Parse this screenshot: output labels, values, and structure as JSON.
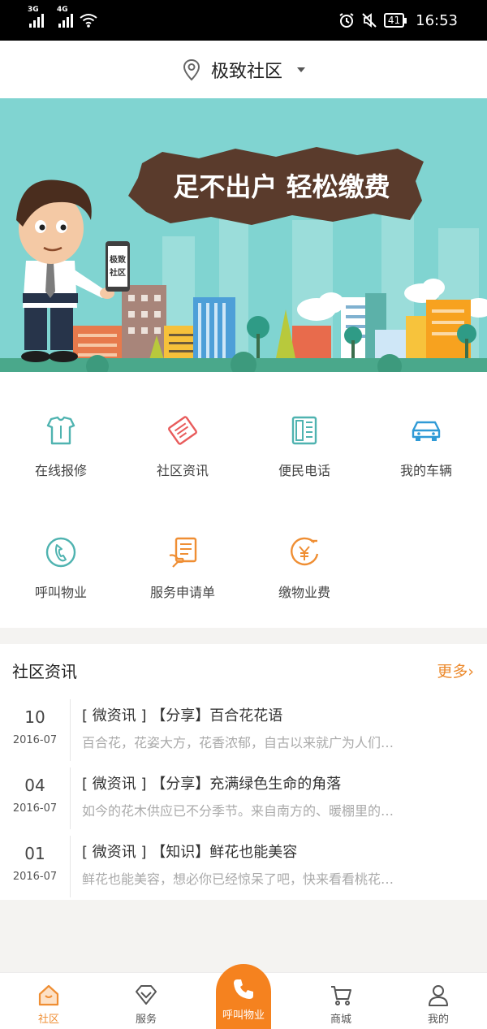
{
  "status_bar": {
    "net1": "3G",
    "net2": "4G",
    "battery": "41",
    "time": "16:53"
  },
  "header": {
    "title": "极致社区"
  },
  "banner": {
    "slogan": "足不出户  轻松缴费",
    "phone_text_1": "极致",
    "phone_text_2": "社区"
  },
  "grid": [
    {
      "label": "在线报修",
      "icon": "clothes-repair-icon"
    },
    {
      "label": "社区资讯",
      "icon": "newspaper-icon"
    },
    {
      "label": "便民电话",
      "icon": "fax-phone-icon"
    },
    {
      "label": "我的车辆",
      "icon": "car-icon"
    },
    {
      "label": "呼叫物业",
      "icon": "call-icon"
    },
    {
      "label": "服务申请单",
      "icon": "form-hand-icon"
    },
    {
      "label": "缴物业费",
      "icon": "yen-payment-icon"
    }
  ],
  "news": {
    "title": "社区资讯",
    "more": "更多›",
    "items": [
      {
        "day": "10",
        "date": "2016-07",
        "headline": "[ 微资讯 ] 【分享】百合花花语",
        "summary": "百合花，花姿大方，花香浓郁，自古以来就广为人们…"
      },
      {
        "day": "04",
        "date": "2016-07",
        "headline": "[ 微资讯 ] 【分享】充满绿色生命的角落",
        "summary": "如今的花木供应已不分季节。来自南方的、暖棚里的…"
      },
      {
        "day": "01",
        "date": "2016-07",
        "headline": "[ 微资讯 ] 【知识】鲜花也能美容",
        "summary": "鲜花也能美容，想必你已经惊呆了吧，快来看看桃花…"
      }
    ]
  },
  "tabbar": {
    "items": [
      {
        "label": "社区",
        "icon": "home-icon",
        "active": true
      },
      {
        "label": "服务",
        "icon": "diamond-icon",
        "active": false
      },
      {
        "label": "呼叫物业",
        "icon": "phone-icon",
        "active": false
      },
      {
        "label": "商城",
        "icon": "cart-icon",
        "active": false
      },
      {
        "label": "我的",
        "icon": "user-icon",
        "active": false
      }
    ]
  },
  "colors": {
    "accent": "#f5821f",
    "teal": "#4fb3b0",
    "banner_bg": "#7fd3d2"
  }
}
